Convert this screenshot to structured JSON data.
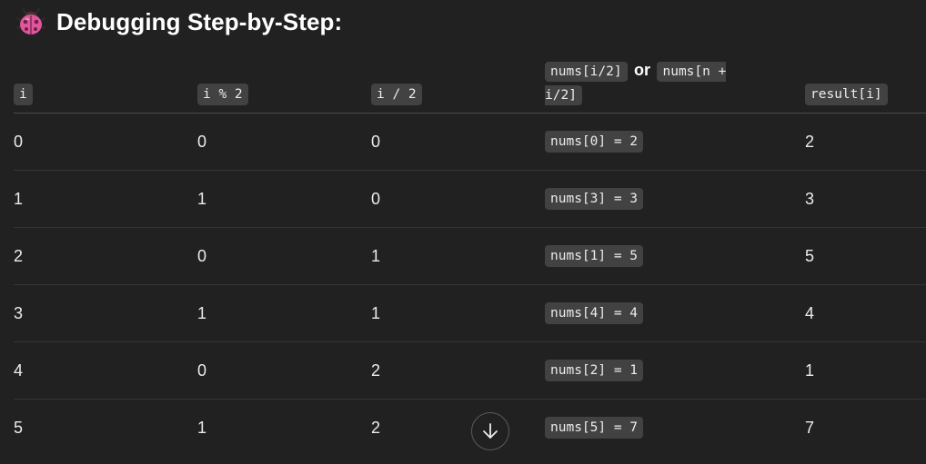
{
  "heading": {
    "icon": "ladybug-icon",
    "title": "Debugging Step-by-Step:"
  },
  "table": {
    "headers": {
      "i": "i",
      "mod": "i % 2",
      "div": "i / 2",
      "pick_a": "nums[i/2]",
      "or": "or",
      "pick_b": "nums[n + i/2]",
      "result": "result[i]"
    },
    "rows": [
      {
        "i": "0",
        "mod": "0",
        "div": "0",
        "pick": "nums[0] = 2",
        "result": "2"
      },
      {
        "i": "1",
        "mod": "1",
        "div": "0",
        "pick": "nums[3] = 3",
        "result": "3"
      },
      {
        "i": "2",
        "mod": "0",
        "div": "1",
        "pick": "nums[1] = 5",
        "result": "5"
      },
      {
        "i": "3",
        "mod": "1",
        "div": "1",
        "pick": "nums[4] = 4",
        "result": "4"
      },
      {
        "i": "4",
        "mod": "0",
        "div": "2",
        "pick": "nums[2] = 1",
        "result": "1"
      },
      {
        "i": "5",
        "mod": "1",
        "div": "2",
        "pick": "nums[5] = 7",
        "result": "7"
      }
    ]
  },
  "scroll_button": {
    "icon": "arrow-down-icon"
  },
  "colors": {
    "background": "#212121",
    "code_background": "#424242",
    "text": "#ececec",
    "ladybug": "#e0569b"
  }
}
